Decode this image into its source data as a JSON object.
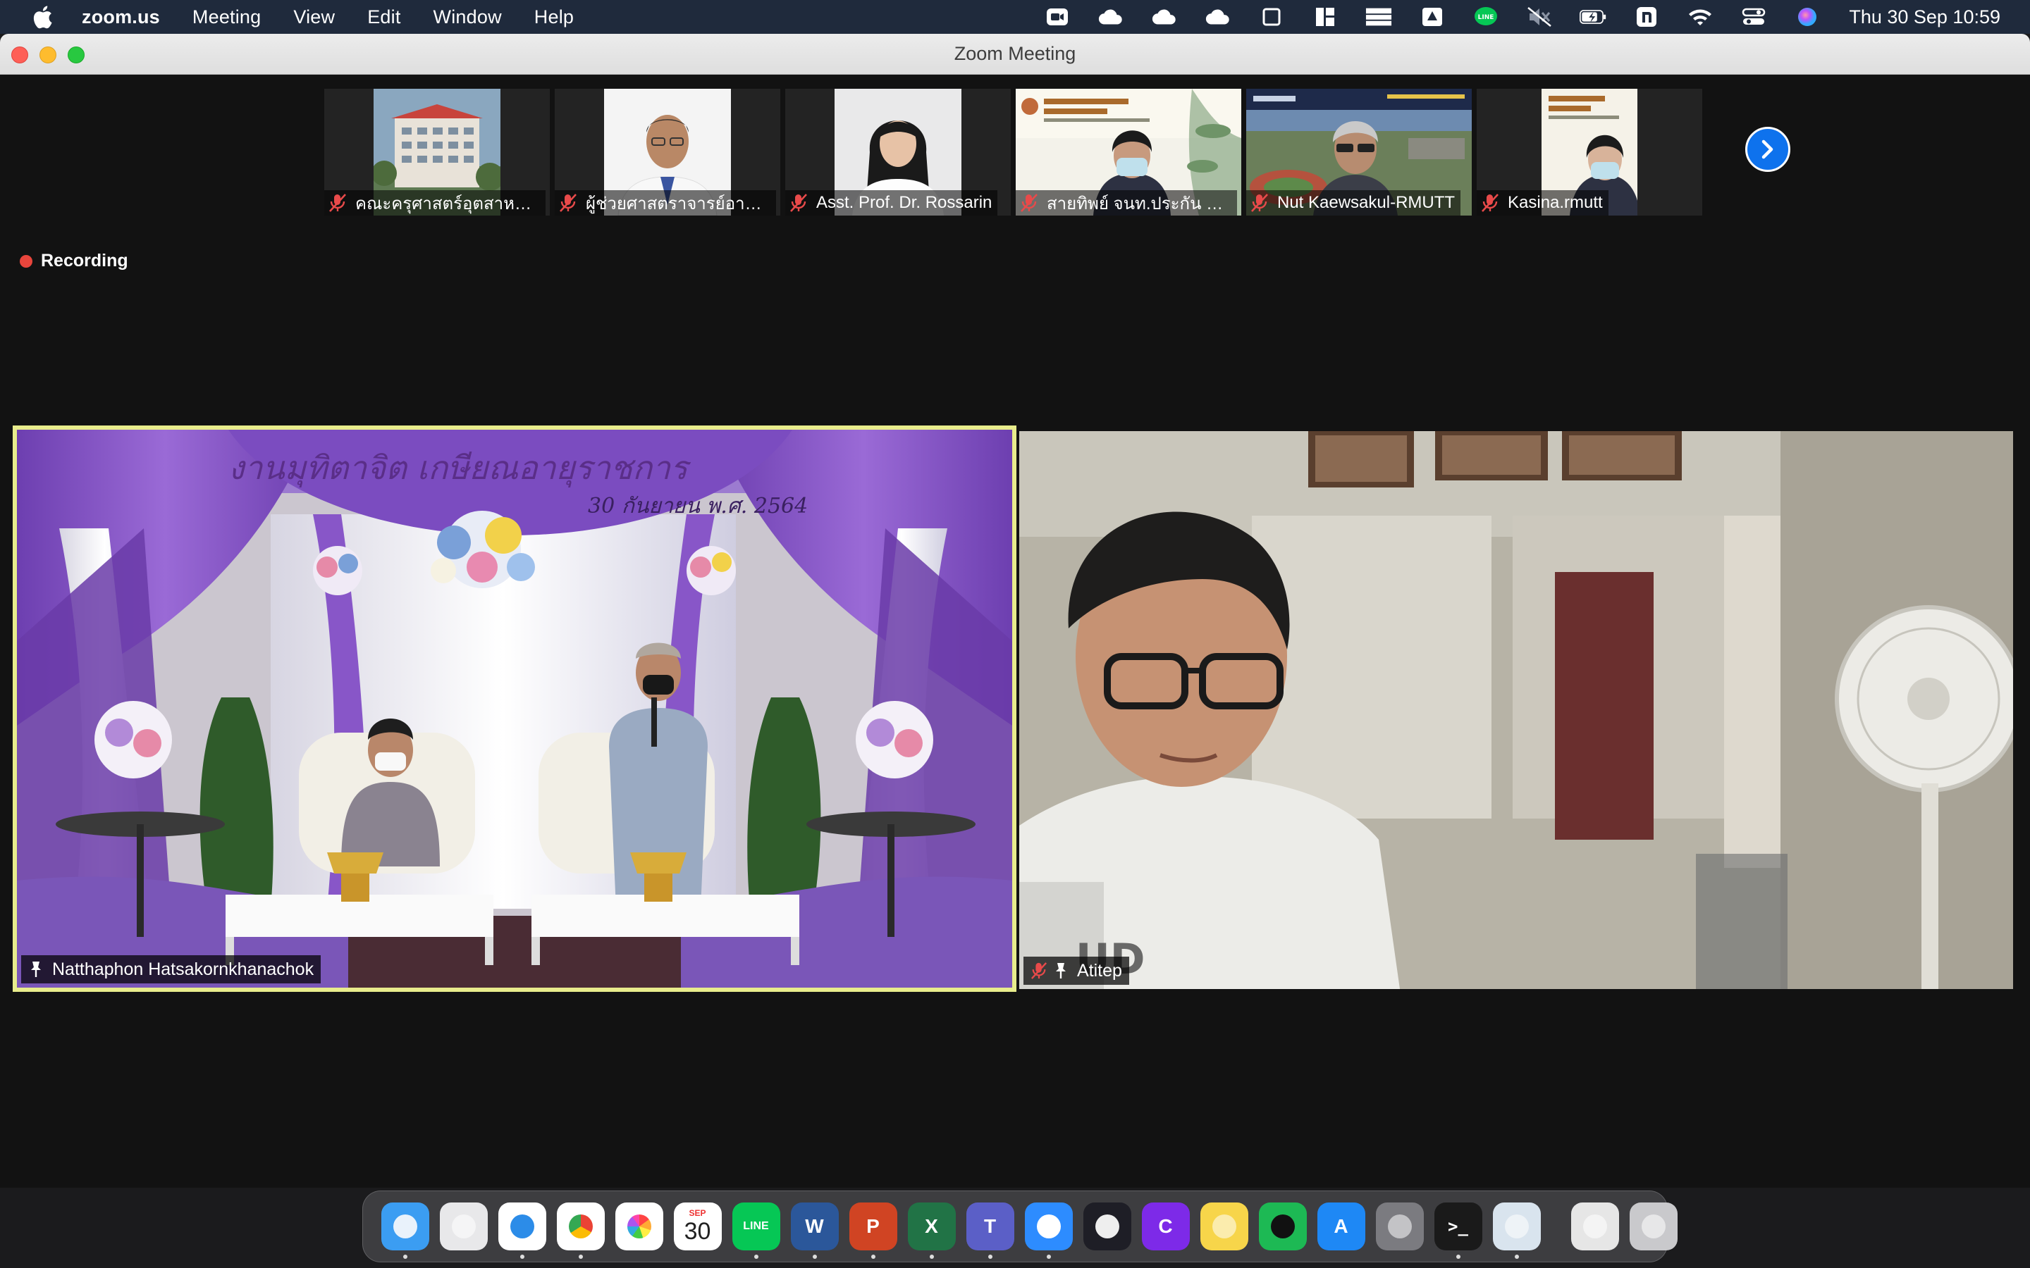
{
  "menubar": {
    "app": "zoom.us",
    "items": [
      "Meeting",
      "View",
      "Edit",
      "Window",
      "Help"
    ],
    "clock": "Thu 30 Sep  10:59",
    "status_icons": [
      "zoom-camera-icon",
      "cloud-icon",
      "cloud-icon",
      "cloud-icon",
      "window-icon",
      "dashboard-icon",
      "cards-icon",
      "drive-icon",
      "line-icon",
      "muted-speaker-icon",
      "battery-icon",
      "n-app-icon",
      "wifi-icon",
      "control-center-icon",
      "siri-icon"
    ]
  },
  "window": {
    "title": "Zoom Meeting"
  },
  "thumbnails": [
    {
      "name": "คณะครุศาสตร์อุตสาหกรรม",
      "muted": true,
      "scene": "building"
    },
    {
      "name": "ผู้ช่วยศาสตราจารย์อานนท์",
      "muted": true,
      "scene": "portrait-man"
    },
    {
      "name": "Asst. Prof. Dr. Rossarin",
      "muted": true,
      "scene": "portrait-woman"
    },
    {
      "name": "สายทิพย์ จนท.ประกัน คอม",
      "muted": true,
      "scene": "poster-woman"
    },
    {
      "name": "Nut Kaewsakul-RMUTT",
      "muted": true,
      "scene": "campus-man"
    },
    {
      "name": "Kasina.rmutt",
      "muted": true,
      "scene": "poster-woman2"
    }
  ],
  "recording": {
    "label": "Recording"
  },
  "videos": {
    "left": {
      "name": "Natthaphon Hatsakornkhanachok",
      "banner": "งานมุทิตาจิต เกษียณอายุราชการ",
      "date_banner": "30 กันยายน พ.ศ. 2564",
      "pinned": true,
      "active_speaker": true
    },
    "right": {
      "name": "Atitep",
      "muted": true,
      "pinned": true
    }
  },
  "dock": {
    "apps": [
      {
        "name": "finder",
        "color": "#3b9df2",
        "glyph": "",
        "running": true
      },
      {
        "name": "launchpad",
        "color": "#e8e8ea",
        "glyph": "",
        "running": false
      },
      {
        "name": "safari",
        "color": "#ffffff",
        "glyph": "",
        "running": true
      },
      {
        "name": "chrome",
        "color": "#ffffff",
        "glyph": "",
        "running": true
      },
      {
        "name": "photos",
        "color": "#ffffff",
        "glyph": "",
        "running": false
      },
      {
        "name": "calendar",
        "color": "#ffffff",
        "glyph": "30",
        "month": "SEP",
        "running": false
      },
      {
        "name": "line",
        "color": "#06c755",
        "glyph": "LINE",
        "running": true
      },
      {
        "name": "word",
        "color": "#2b579a",
        "glyph": "W",
        "running": true
      },
      {
        "name": "powerpoint",
        "color": "#d04423",
        "glyph": "P",
        "running": true
      },
      {
        "name": "excel",
        "color": "#217346",
        "glyph": "X",
        "running": true
      },
      {
        "name": "teams",
        "color": "#5b5fc7",
        "glyph": "T",
        "running": true
      },
      {
        "name": "zoom",
        "color": "#2d8cff",
        "glyph": "",
        "running": true
      },
      {
        "name": "obs",
        "color": "#1e1e26",
        "glyph": "",
        "running": false
      },
      {
        "name": "canva",
        "color": "#7d2ae8",
        "glyph": "C",
        "running": false
      },
      {
        "name": "notes",
        "color": "#f7d54a",
        "glyph": "",
        "running": false
      },
      {
        "name": "spotify",
        "color": "#1db954",
        "glyph": "",
        "running": false
      },
      {
        "name": "app-store",
        "color": "#1e88f5",
        "glyph": "A",
        "running": false
      },
      {
        "name": "system-preferences",
        "color": "#7b7b80",
        "glyph": "",
        "running": false
      },
      {
        "name": "terminal",
        "color": "#1a1a1a",
        "glyph": ">_",
        "running": true
      },
      {
        "name": "preview",
        "color": "#d9e4ee",
        "glyph": "",
        "running": true
      }
    ],
    "trailing": [
      {
        "name": "downloads",
        "color": "#e6e6e6"
      },
      {
        "name": "trash",
        "color": "#c9c9cc"
      }
    ]
  }
}
